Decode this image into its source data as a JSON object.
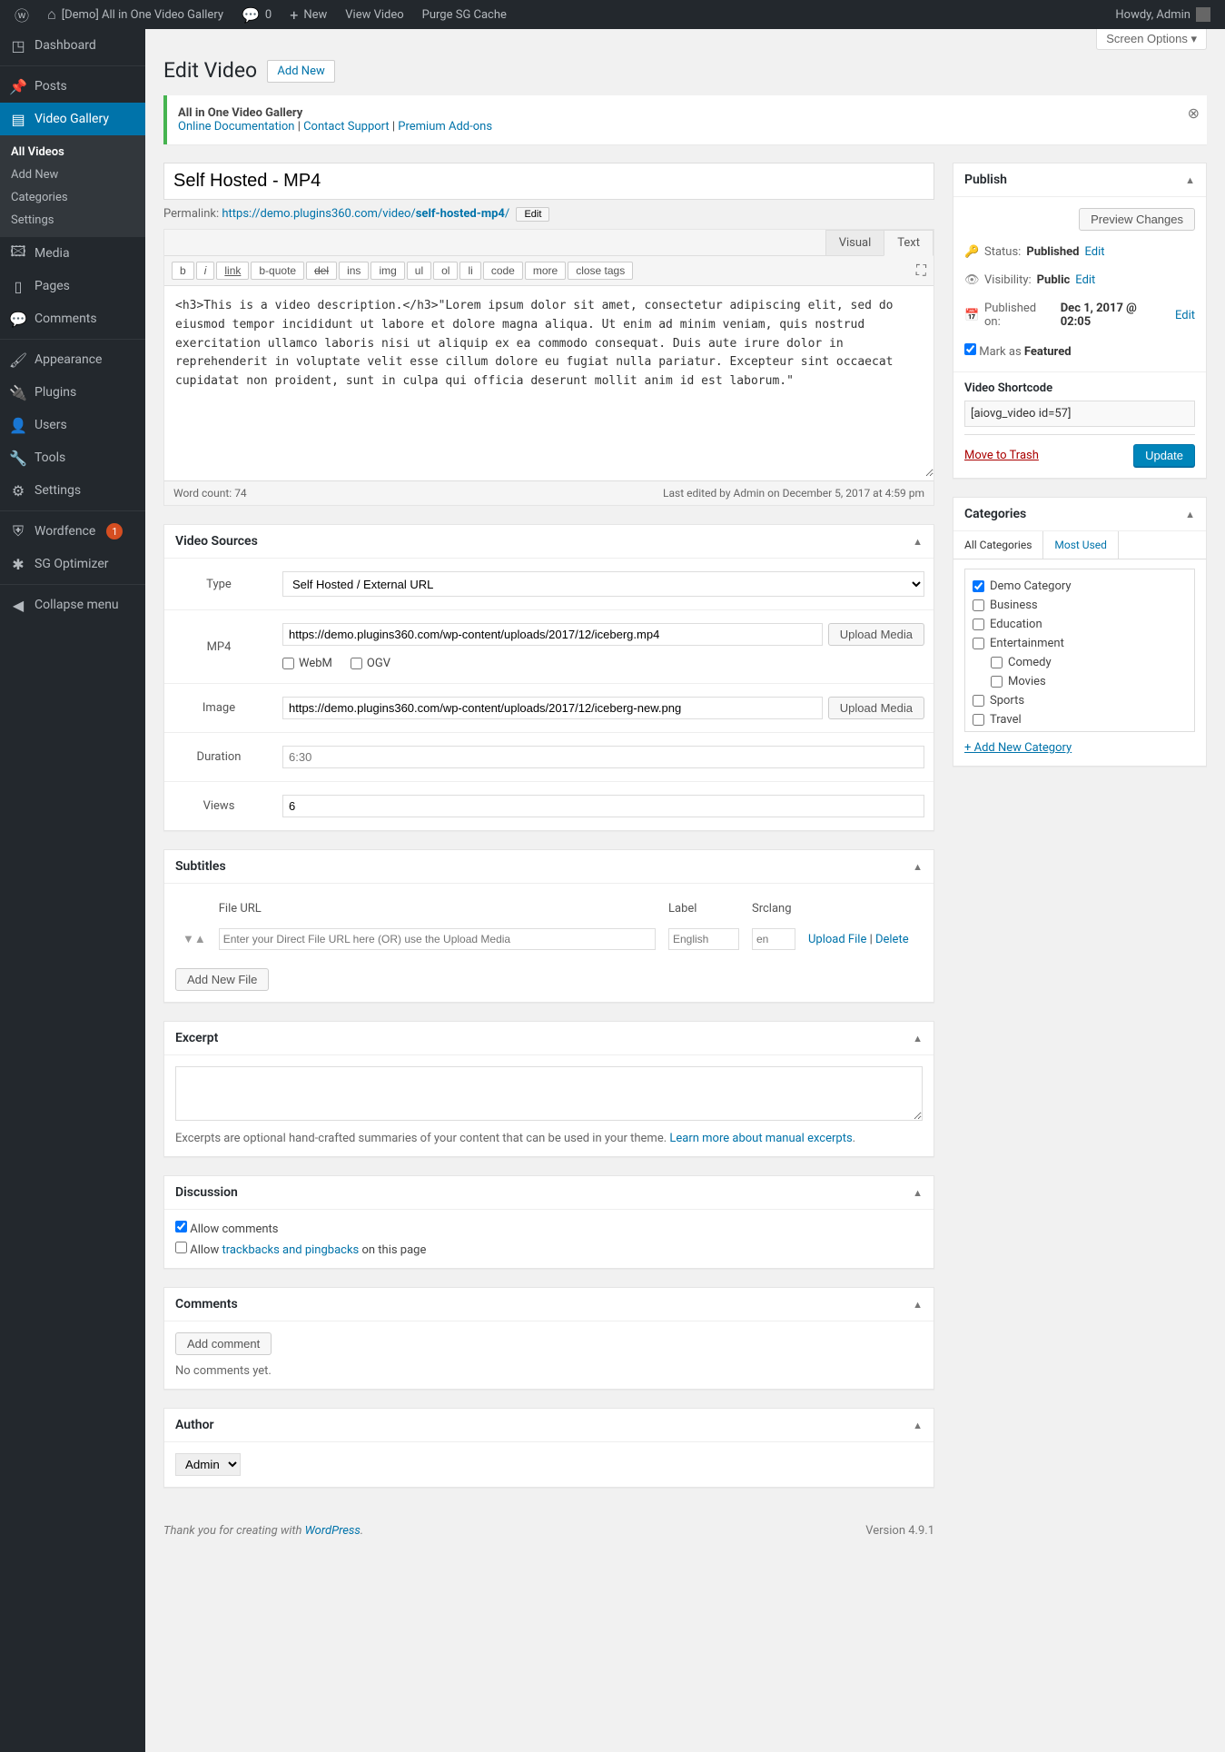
{
  "adminbar": {
    "site_name": "[Demo] All in One Video Gallery",
    "comments_count": "0",
    "new_label": "New",
    "view_video": "View Video",
    "purge_cache": "Purge SG Cache",
    "howdy": "Howdy, Admin"
  },
  "sidebar": {
    "dashboard": "Dashboard",
    "posts": "Posts",
    "video_gallery": "Video Gallery",
    "sub_all": "All Videos",
    "sub_add": "Add New",
    "sub_cat": "Categories",
    "sub_settings": "Settings",
    "media": "Media",
    "pages": "Pages",
    "comments": "Comments",
    "appearance": "Appearance",
    "plugins": "Plugins",
    "users": "Users",
    "tools": "Tools",
    "settings": "Settings",
    "wordfence": "Wordfence",
    "wordfence_badge": "1",
    "sg": "SG Optimizer",
    "collapse": "Collapse menu"
  },
  "screen_options": "Screen Options",
  "page_title": "Edit Video",
  "add_new_btn": "Add New",
  "notice": {
    "brand": "All in One Video Gallery",
    "doc": "Online Documentation",
    "support": "Contact Support",
    "premium": "Premium Add-ons"
  },
  "title_value": "Self Hosted - MP4",
  "permalink": {
    "label": "Permalink:",
    "base": "https://demo.plugins360.com/video/",
    "slug": "self-hosted-mp4",
    "edit": "Edit"
  },
  "editor": {
    "tab_visual": "Visual",
    "tab_text": "Text",
    "qt_b": "b",
    "qt_i": "i",
    "qt_link": "link",
    "qt_bquote": "b-quote",
    "qt_del": "del",
    "qt_ins": "ins",
    "qt_img": "img",
    "qt_ul": "ul",
    "qt_ol": "ol",
    "qt_li": "li",
    "qt_code": "code",
    "qt_more": "more",
    "qt_close": "close tags",
    "content": "<h3>This is a video description.</h3>\"Lorem ipsum dolor sit amet, consectetur adipiscing elit, sed do eiusmod tempor incididunt ut labore et dolore magna aliqua. Ut enim ad minim veniam, quis nostrud exercitation ullamco laboris nisi ut aliquip ex ea commodo consequat. Duis aute irure dolor in reprehenderit in voluptate velit esse cillum dolore eu fugiat nulla pariatur. Excepteur sint occaecat cupidatat non proident, sunt in culpa qui officia deserunt mollit anim id est laborum.\"",
    "word_count_label": "Word count: ",
    "word_count": "74",
    "last_edited": "Last edited by Admin on December 5, 2017 at 4:59 pm"
  },
  "video_sources": {
    "title": "Video Sources",
    "type_label": "Type",
    "type_value": "Self Hosted / External URL",
    "mp4_label": "MP4",
    "mp4_value": "https://demo.plugins360.com/wp-content/uploads/2017/12/iceberg.mp4",
    "upload_media": "Upload Media",
    "webm_label": "WebM",
    "ogv_label": "OGV",
    "image_label": "Image",
    "image_value": "https://demo.plugins360.com/wp-content/uploads/2017/12/iceberg-new.png",
    "duration_label": "Duration",
    "duration_placeholder": "6:30",
    "views_label": "Views",
    "views_value": "6"
  },
  "subtitles": {
    "title": "Subtitles",
    "col_file": "File URL",
    "col_label": "Label",
    "col_srclang": "Srclang",
    "file_placeholder": "Enter your Direct File URL here (OR) use the Upload Media",
    "label_placeholder": "English",
    "srclang_placeholder": "en",
    "upload": "Upload File",
    "delete": "Delete",
    "add_new_file": "Add New File"
  },
  "excerpt": {
    "title": "Excerpt",
    "help_prefix": "Excerpts are optional hand-crafted summaries of your content that can be used in your theme. ",
    "help_link": "Learn more about manual excerpts"
  },
  "discussion": {
    "title": "Discussion",
    "allow_comments": "Allow comments",
    "allow_prefix": "Allow ",
    "trackbacks": "trackbacks and pingbacks",
    "on_this_page": " on this page"
  },
  "comments_box": {
    "title": "Comments",
    "add_comment": "Add comment",
    "no_comments": "No comments yet."
  },
  "author_box": {
    "title": "Author",
    "value": "Admin"
  },
  "publish": {
    "title": "Publish",
    "preview": "Preview Changes",
    "status_label": "Status:",
    "status_value": "Published",
    "edit": "Edit",
    "vis_label": "Visibility:",
    "vis_value": "Public",
    "pubon_label": "Published on:",
    "pubon_value": "Dec 1, 2017 @ 02:05",
    "mark_featured": "Mark as",
    "featured": "Featured",
    "shortcode_label": "Video Shortcode",
    "shortcode_value": "[aiovg_video id=57]",
    "trash": "Move to Trash",
    "update": "Update"
  },
  "categories": {
    "title": "Categories",
    "tab_all": "All Categories",
    "tab_most": "Most Used",
    "items": [
      {
        "name": "Demo Category",
        "checked": true,
        "indent": false
      },
      {
        "name": "Business",
        "checked": false,
        "indent": false
      },
      {
        "name": "Education",
        "checked": false,
        "indent": false
      },
      {
        "name": "Entertainment",
        "checked": false,
        "indent": false
      },
      {
        "name": "Comedy",
        "checked": false,
        "indent": true
      },
      {
        "name": "Movies",
        "checked": false,
        "indent": true
      },
      {
        "name": "Sports",
        "checked": false,
        "indent": false
      },
      {
        "name": "Travel",
        "checked": false,
        "indent": false
      }
    ],
    "add_new": "+ Add New Category"
  },
  "footer": {
    "thank_prefix": "Thank you for creating with ",
    "wordpress": "WordPress",
    "version": "Version 4.9.1"
  }
}
